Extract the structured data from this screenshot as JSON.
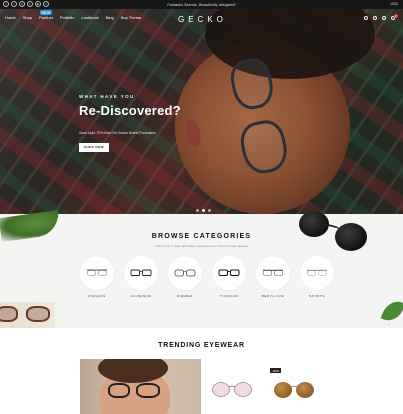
{
  "topbar": {
    "announcement": "Fantastic Brands, Beautifully designed!",
    "currency": "USD",
    "socials": [
      {
        "name": "facebook-icon",
        "glyph": "f"
      },
      {
        "name": "twitter-icon",
        "glyph": "t"
      },
      {
        "name": "instagram-icon",
        "glyph": "◎"
      },
      {
        "name": "pinterest-icon",
        "glyph": "p"
      },
      {
        "name": "youtube-icon",
        "glyph": "▶"
      },
      {
        "name": "vimeo-icon",
        "glyph": "v"
      }
    ]
  },
  "nav": {
    "menu": [
      "Home",
      "Shop",
      "Product",
      "Portfolio",
      "Lookbook",
      "Blog",
      "Buy Theme"
    ],
    "new_badge": "NEW",
    "logo": "GECKO",
    "cart_count": "0"
  },
  "hero": {
    "eyebrow": "WHAT HAVE YOU",
    "headline": "Re-Discovered?",
    "subline": "Save Upto 70% Now On Gecko Brand Purchases",
    "cta": "SHOP NOW"
  },
  "browse": {
    "title": "BROWSE CATEGORIES",
    "subtitle": "This is best in class affordable eyeglasses from famous brand glasses",
    "categories": [
      "RIMLESS",
      "ALUMINUM",
      "RIMMED",
      "TITANIUM",
      "BERYLLIUM",
      "SPORTS"
    ]
  },
  "trending": {
    "title": "TRENDING EYEWEAR",
    "product_badge": "-20%"
  },
  "colors": {
    "accent": "#2c9be6",
    "dark": "#171717",
    "browse_bg": "#f4f4f2"
  }
}
